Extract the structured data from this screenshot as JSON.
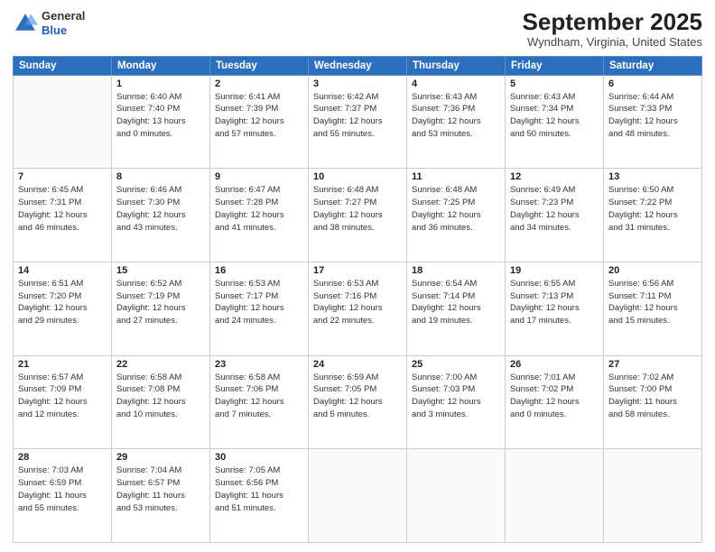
{
  "header": {
    "logo_line1": "General",
    "logo_line2": "Blue",
    "month_year": "September 2025",
    "location": "Wyndham, Virginia, United States"
  },
  "weekdays": [
    "Sunday",
    "Monday",
    "Tuesday",
    "Wednesday",
    "Thursday",
    "Friday",
    "Saturday"
  ],
  "weeks": [
    [
      {
        "day": "",
        "info": ""
      },
      {
        "day": "1",
        "info": "Sunrise: 6:40 AM\nSunset: 7:40 PM\nDaylight: 13 hours\nand 0 minutes."
      },
      {
        "day": "2",
        "info": "Sunrise: 6:41 AM\nSunset: 7:39 PM\nDaylight: 12 hours\nand 57 minutes."
      },
      {
        "day": "3",
        "info": "Sunrise: 6:42 AM\nSunset: 7:37 PM\nDaylight: 12 hours\nand 55 minutes."
      },
      {
        "day": "4",
        "info": "Sunrise: 6:43 AM\nSunset: 7:36 PM\nDaylight: 12 hours\nand 53 minutes."
      },
      {
        "day": "5",
        "info": "Sunrise: 6:43 AM\nSunset: 7:34 PM\nDaylight: 12 hours\nand 50 minutes."
      },
      {
        "day": "6",
        "info": "Sunrise: 6:44 AM\nSunset: 7:33 PM\nDaylight: 12 hours\nand 48 minutes."
      }
    ],
    [
      {
        "day": "7",
        "info": "Sunrise: 6:45 AM\nSunset: 7:31 PM\nDaylight: 12 hours\nand 46 minutes."
      },
      {
        "day": "8",
        "info": "Sunrise: 6:46 AM\nSunset: 7:30 PM\nDaylight: 12 hours\nand 43 minutes."
      },
      {
        "day": "9",
        "info": "Sunrise: 6:47 AM\nSunset: 7:28 PM\nDaylight: 12 hours\nand 41 minutes."
      },
      {
        "day": "10",
        "info": "Sunrise: 6:48 AM\nSunset: 7:27 PM\nDaylight: 12 hours\nand 38 minutes."
      },
      {
        "day": "11",
        "info": "Sunrise: 6:48 AM\nSunset: 7:25 PM\nDaylight: 12 hours\nand 36 minutes."
      },
      {
        "day": "12",
        "info": "Sunrise: 6:49 AM\nSunset: 7:23 PM\nDaylight: 12 hours\nand 34 minutes."
      },
      {
        "day": "13",
        "info": "Sunrise: 6:50 AM\nSunset: 7:22 PM\nDaylight: 12 hours\nand 31 minutes."
      }
    ],
    [
      {
        "day": "14",
        "info": "Sunrise: 6:51 AM\nSunset: 7:20 PM\nDaylight: 12 hours\nand 29 minutes."
      },
      {
        "day": "15",
        "info": "Sunrise: 6:52 AM\nSunset: 7:19 PM\nDaylight: 12 hours\nand 27 minutes."
      },
      {
        "day": "16",
        "info": "Sunrise: 6:53 AM\nSunset: 7:17 PM\nDaylight: 12 hours\nand 24 minutes."
      },
      {
        "day": "17",
        "info": "Sunrise: 6:53 AM\nSunset: 7:16 PM\nDaylight: 12 hours\nand 22 minutes."
      },
      {
        "day": "18",
        "info": "Sunrise: 6:54 AM\nSunset: 7:14 PM\nDaylight: 12 hours\nand 19 minutes."
      },
      {
        "day": "19",
        "info": "Sunrise: 6:55 AM\nSunset: 7:13 PM\nDaylight: 12 hours\nand 17 minutes."
      },
      {
        "day": "20",
        "info": "Sunrise: 6:56 AM\nSunset: 7:11 PM\nDaylight: 12 hours\nand 15 minutes."
      }
    ],
    [
      {
        "day": "21",
        "info": "Sunrise: 6:57 AM\nSunset: 7:09 PM\nDaylight: 12 hours\nand 12 minutes."
      },
      {
        "day": "22",
        "info": "Sunrise: 6:58 AM\nSunset: 7:08 PM\nDaylight: 12 hours\nand 10 minutes."
      },
      {
        "day": "23",
        "info": "Sunrise: 6:58 AM\nSunset: 7:06 PM\nDaylight: 12 hours\nand 7 minutes."
      },
      {
        "day": "24",
        "info": "Sunrise: 6:59 AM\nSunset: 7:05 PM\nDaylight: 12 hours\nand 5 minutes."
      },
      {
        "day": "25",
        "info": "Sunrise: 7:00 AM\nSunset: 7:03 PM\nDaylight: 12 hours\nand 3 minutes."
      },
      {
        "day": "26",
        "info": "Sunrise: 7:01 AM\nSunset: 7:02 PM\nDaylight: 12 hours\nand 0 minutes."
      },
      {
        "day": "27",
        "info": "Sunrise: 7:02 AM\nSunset: 7:00 PM\nDaylight: 11 hours\nand 58 minutes."
      }
    ],
    [
      {
        "day": "28",
        "info": "Sunrise: 7:03 AM\nSunset: 6:59 PM\nDaylight: 11 hours\nand 55 minutes."
      },
      {
        "day": "29",
        "info": "Sunrise: 7:04 AM\nSunset: 6:57 PM\nDaylight: 11 hours\nand 53 minutes."
      },
      {
        "day": "30",
        "info": "Sunrise: 7:05 AM\nSunset: 6:56 PM\nDaylight: 11 hours\nand 51 minutes."
      },
      {
        "day": "",
        "info": ""
      },
      {
        "day": "",
        "info": ""
      },
      {
        "day": "",
        "info": ""
      },
      {
        "day": "",
        "info": ""
      }
    ]
  ]
}
